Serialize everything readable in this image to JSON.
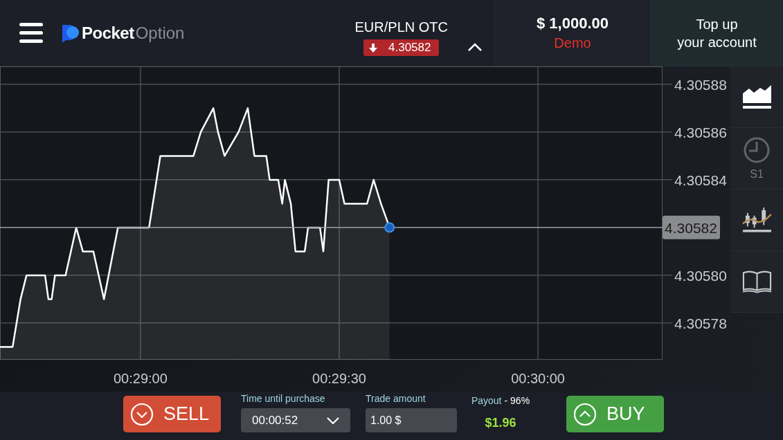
{
  "header": {
    "logo": {
      "brand_bold": "Pocket",
      "brand_light": "Option"
    },
    "asset": {
      "pair": "EUR/PLN OTC",
      "price": "4.30582",
      "falling": true,
      "expanded": false
    },
    "balance": {
      "amount": "$ 1,000.00",
      "account": "Demo"
    },
    "top_up_button": "Top up\nyour account"
  },
  "chart": {
    "chart_data": {
      "type": "area",
      "grid": true,
      "ref_lines": [
        {
          "axis": "y",
          "value": 4.30582,
          "label": "4.30582"
        }
      ],
      "xticks": [
        {
          "value": 1740,
          "label": "00:29:00"
        },
        {
          "value": 1770,
          "label": "00:29:30"
        },
        {
          "value": 1800,
          "label": "00:30:00"
        }
      ],
      "yticks": [
        {
          "value": 4.30588,
          "label": "4.30588"
        },
        {
          "value": 4.30586,
          "label": "4.30586"
        },
        {
          "value": 4.30584,
          "label": "4.30584"
        },
        {
          "value": 4.3058,
          "label": "4.30580"
        },
        {
          "value": 4.30578,
          "label": "4.30578"
        }
      ],
      "xlim": [
        1718.8,
        1818.8
      ],
      "ylim": [
        4.3057646,
        4.3058875
      ],
      "series": [
        {
          "color": "#ffffff",
          "x": [
            1718.8,
            1720.7,
            1721.9,
            1722.8,
            1725.6,
            1726.1,
            1726.6,
            1727.1,
            1728.7,
            1730.3,
            1731.3,
            1732.9,
            1734.5,
            1736.6,
            1741.3,
            1743.0,
            1748.0,
            1749.1,
            1751.0,
            1751.7,
            1752.7,
            1754.8,
            1756.2,
            1757.2,
            1759.0,
            1759.5,
            1760.8,
            1761.4,
            1761.8,
            1762.7,
            1763.4,
            1764.8,
            1765.3,
            1767.1,
            1767.6,
            1768.4,
            1770.0,
            1770.8,
            1774.2,
            1775.2,
            1776.3,
            1777.6
          ],
          "values": [
            4.30577,
            4.30577,
            4.30579,
            4.3058,
            4.3058,
            4.30579,
            4.30579,
            4.3058,
            4.3058,
            4.30582,
            4.30581,
            4.30581,
            4.30579,
            4.30582,
            4.30582,
            4.30585,
            4.30585,
            4.30586,
            4.30587,
            4.30586,
            4.30585,
            4.30586,
            4.30587,
            4.30585,
            4.30585,
            4.30584,
            4.30584,
            4.30583,
            4.30584,
            4.30583,
            4.30581,
            4.30581,
            4.30582,
            4.30582,
            4.30581,
            4.30584,
            4.30584,
            4.30583,
            4.30583,
            4.30584,
            4.30583,
            4.30582
          ]
        }
      ]
    }
  },
  "tools": [
    {
      "kind": "area",
      "selected": true
    },
    {
      "kind": "timeframe",
      "label": "S1",
      "selected": false
    },
    {
      "kind": "indicators",
      "selected": false
    },
    {
      "kind": "guide",
      "selected": false
    }
  ],
  "trade_bar": {
    "sell_button": "SELL",
    "time": {
      "label": "Time until purchase",
      "value": "00:00:52"
    },
    "amount": {
      "label": "Trade amount",
      "value": "1.00 $"
    },
    "payout": {
      "label": "Payout",
      "percent": "- 96%",
      "profit": "$1.96"
    },
    "buy_button": "BUY"
  }
}
